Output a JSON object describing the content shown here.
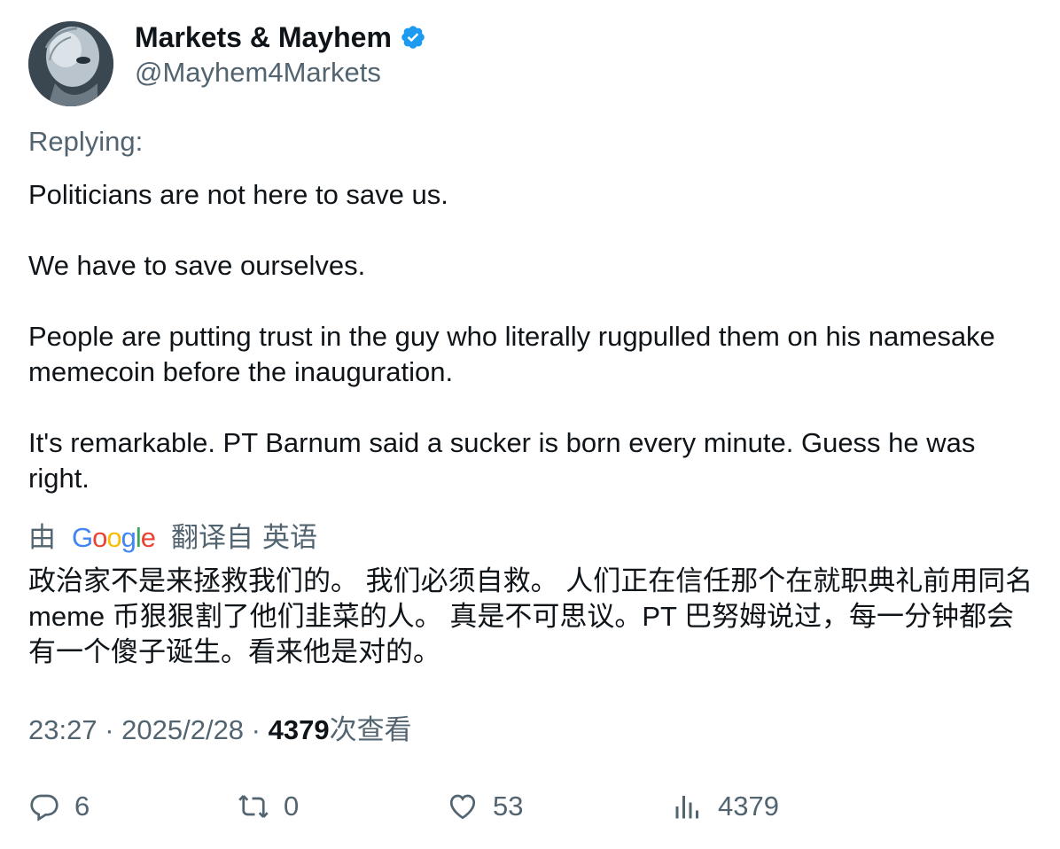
{
  "author": {
    "display_name": "Markets & Mayhem",
    "handle": "@Mayhem4Markets",
    "avatar_icon": "robot-head-avatar",
    "verified": true
  },
  "replying_label": "Replying:",
  "tweet": {
    "paragraphs": [
      "Politicians are not here to save us.",
      "We have to save ourselves.",
      "People are putting trust in the guy who literally rugpulled them on his namesake memecoin before the inauguration.",
      "It's remarkable. PT Barnum said a sucker is born every minute. Guess he was right."
    ]
  },
  "translation": {
    "by_label": "由",
    "provider": "Google",
    "from_label": "翻译自",
    "language": "英语",
    "text": "政治家不是来拯救我们的。 我们必须自救。 人们正在信任那个在就职典礼前用同名 meme 币狠狠割了他们韭菜的人。 真是不可思议。PT 巴努姆说过，每一分钟都会有一个傻子诞生。看来他是对的。"
  },
  "meta": {
    "time": "23:27",
    "separator": " · ",
    "date": "2025/2/28",
    "views_count": "4379",
    "views_label": "次查看"
  },
  "actions": {
    "replies": "6",
    "retweets": "0",
    "likes": "53",
    "views": "4379"
  },
  "colors": {
    "text": "#0f1419",
    "secondary": "#536471",
    "verified": "#1d9bf0"
  }
}
